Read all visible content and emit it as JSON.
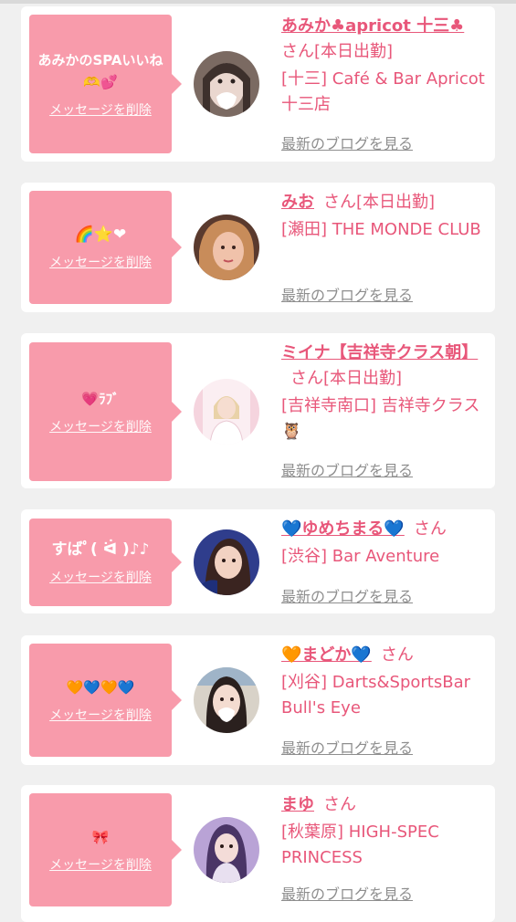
{
  "cards": [
    {
      "message": "あみかのSPAいいね🫶💕",
      "delete_label": "メッセージを削除",
      "name": "あみか♣apricot 十三♣",
      "suffix": "さん[本日出勤]",
      "shop": "[十三] Café & Bar Apricot 十三店",
      "blog_label": "最新のブログを見る",
      "avatar_icon": "avatar-photo"
    },
    {
      "message": "🌈⭐❤",
      "delete_label": "メッセージを削除",
      "name": "みお",
      "suffix": "さん[本日出勤]",
      "shop": "[瀬田] THE MONDE CLUB",
      "blog_label": "最新のブログを見る",
      "avatar_icon": "avatar-photo"
    },
    {
      "message": "💗ﾗﾌﾞ",
      "delete_label": "メッセージを削除",
      "name": "ミイナ【吉祥寺クラス朝】",
      "suffix": "さん[本日出勤]",
      "shop": "[吉祥寺南口] 吉祥寺クラス🦉",
      "blog_label": "最新のブログを見る",
      "avatar_icon": "avatar-photo"
    },
    {
      "message": "すばﾟ( ᐛ )♪♪",
      "delete_label": "メッセージを削除",
      "name": "💙ゆめちまる💙",
      "suffix": "さん",
      "shop": "[渋谷] Bar Aventure",
      "blog_label": "最新のブログを見る",
      "avatar_icon": "avatar-photo"
    },
    {
      "message": "🧡💙🧡💙",
      "delete_label": "メッセージを削除",
      "name": "🧡まどか💙",
      "suffix": "さん",
      "shop": "[刈谷] Darts&SportsBar Bull's Eye",
      "blog_label": "最新のブログを見る",
      "avatar_icon": "avatar-photo"
    },
    {
      "message": "🎀",
      "delete_label": "メッセージを削除",
      "name": "まゆ",
      "suffix": "さん",
      "shop": "[秋葉原] HIGH-SPEC PRINCESS",
      "blog_label": "最新のブログを見る",
      "avatar_icon": "avatar-photo"
    }
  ],
  "colors": {
    "accent_pink": "#e8577a",
    "bubble_pink": "#f89bab",
    "link_gray": "#8e8e8e",
    "page_bg": "#f0f0f0"
  }
}
